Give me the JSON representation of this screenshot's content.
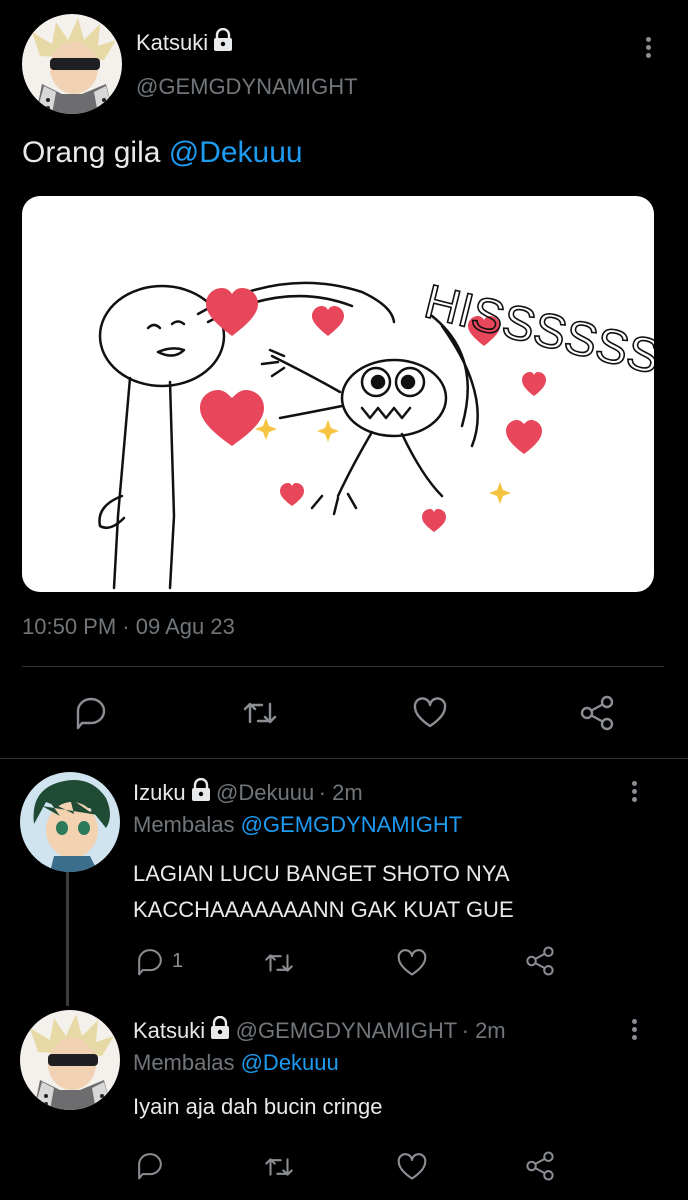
{
  "main_tweet": {
    "author_name": "Katsuki",
    "author_handle": "@GEMGDYNAMIGHT",
    "text_prefix": "Orang gila ",
    "text_mention": "@Dekuuu",
    "image_text": "HISSSSSSS",
    "time": "10:50 PM",
    "separator": "·",
    "date": "09 Agu 23"
  },
  "replies": [
    {
      "author_name": "Izuku",
      "author_handle": "@Dekuuu",
      "time": "· 2m",
      "replying_prefix": "Membalas ",
      "replying_to": "@GEMGDYNAMIGHT",
      "text_line1": "LAGIAN LUCU BANGET SHOTO NYA",
      "text_line2": "KACCHAAAAAAANN GAK KUAT GUE",
      "reply_count": "1"
    },
    {
      "author_name": "Katsuki",
      "author_handle": "@GEMGDYNAMIGHT",
      "time": "· 2m",
      "replying_prefix": "Membalas ",
      "replying_to": "@Dekuuu",
      "text": "Iyain aja dah bucin cringe"
    }
  ],
  "colors": {
    "background": "#000000",
    "text": "#e7e9ea",
    "muted": "#71767b",
    "link": "#1d9bf0",
    "divider": "#2f3336"
  },
  "icons": [
    "lock-icon",
    "more-icon",
    "reply-icon",
    "retweet-icon",
    "like-icon",
    "share-icon"
  ]
}
